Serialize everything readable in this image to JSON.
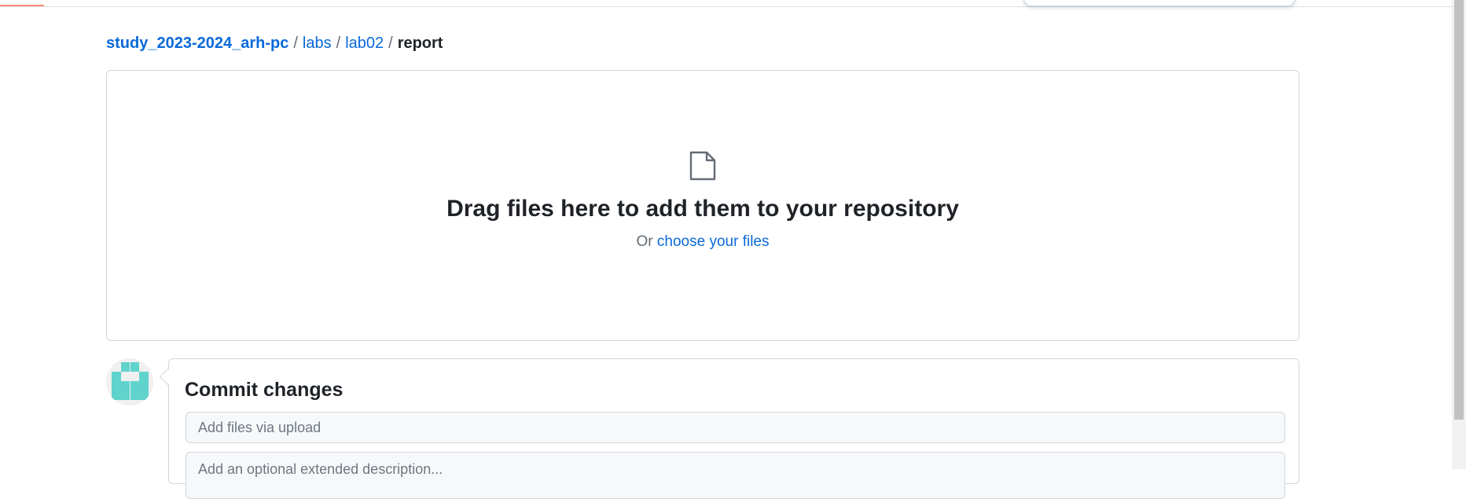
{
  "breadcrumb": {
    "repo": "study_2023-2024_arh-pc",
    "sep": "/",
    "items": [
      "labs",
      "lab02"
    ],
    "current": "report"
  },
  "dropzone": {
    "icon": "file-icon",
    "title": "Drag files here to add them to your repository",
    "or_text": "Or",
    "choose_link": "choose your files"
  },
  "commit": {
    "title": "Commit changes",
    "summary_placeholder": "Add files via upload",
    "description_placeholder": "Add an optional extended description..."
  },
  "colors": {
    "link": "#0969da",
    "avatar": "#5fd3cc",
    "tab_accent": "#fd8c73"
  }
}
